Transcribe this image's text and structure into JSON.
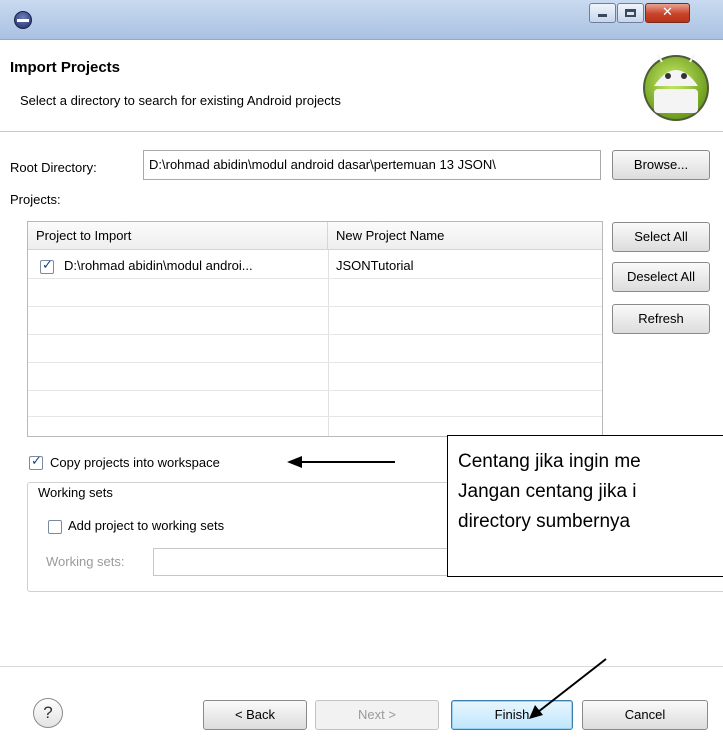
{
  "window": {
    "app_icon": "eclipse-icon",
    "buttons": {
      "minimize": "",
      "maximize": "",
      "close": "✕"
    }
  },
  "header": {
    "title": "Import Projects",
    "description": "Select a directory to search for existing Android projects",
    "logo": "android-logo"
  },
  "root": {
    "label": "Root Directory:",
    "value": "D:\\rohmad abidin\\modul android dasar\\pertemuan 13 JSON\\",
    "browse_label": "Browse..."
  },
  "projects": {
    "label": "Projects:",
    "columns": [
      "Project to Import",
      "New Project Name"
    ],
    "rows": [
      {
        "checked": true,
        "project": "D:\\rohmad abidin\\modul androi...",
        "new_name": "JSONTutorial"
      }
    ],
    "select_all_label": "Select All",
    "deselect_all_label": "Deselect All",
    "refresh_label": "Refresh"
  },
  "copy_into_workspace": {
    "checked": true,
    "label": "Copy projects into workspace"
  },
  "working_sets": {
    "group_title": "Working sets",
    "add_label": "Add project to working sets",
    "add_checked": false,
    "sets_label": "Working sets:",
    "sets_value": ""
  },
  "footer": {
    "help_label": "?",
    "back_label": "< Back",
    "next_label": "Next >",
    "finish_label": "Finish",
    "cancel_label": "Cancel"
  },
  "annotation": {
    "lines": [
      "Centang jika ingin me",
      "Jangan centang jika i",
      "directory sumbernya"
    ]
  }
}
